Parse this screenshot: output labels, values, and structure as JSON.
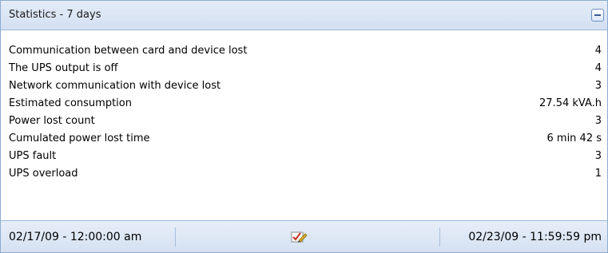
{
  "panel": {
    "title": "Statistics - 7 days",
    "collapse_icon": "minus-icon"
  },
  "stats": [
    {
      "label": "Communication between card and device lost",
      "value": "4"
    },
    {
      "label": "The UPS output is off",
      "value": "4"
    },
    {
      "label": "Network communication with device lost",
      "value": "3"
    },
    {
      "label": "Estimated consumption",
      "value": "27.54 kVA.h"
    },
    {
      "label": "Power lost count",
      "value": "3"
    },
    {
      "label": "Cumulated power lost time",
      "value": "6 min 42 s"
    },
    {
      "label": "UPS fault",
      "value": "3"
    },
    {
      "label": "UPS overload",
      "value": "1"
    }
  ],
  "footer": {
    "start_date": "02/17/09 - 12:00:00 am",
    "end_date": "02/23/09 - 11:59:59 pm",
    "edit_icon": "edit-period-icon"
  },
  "colors": {
    "header_bg": "#d9e4f3",
    "border": "#8eaad4",
    "icon_check": "#c0392b"
  }
}
